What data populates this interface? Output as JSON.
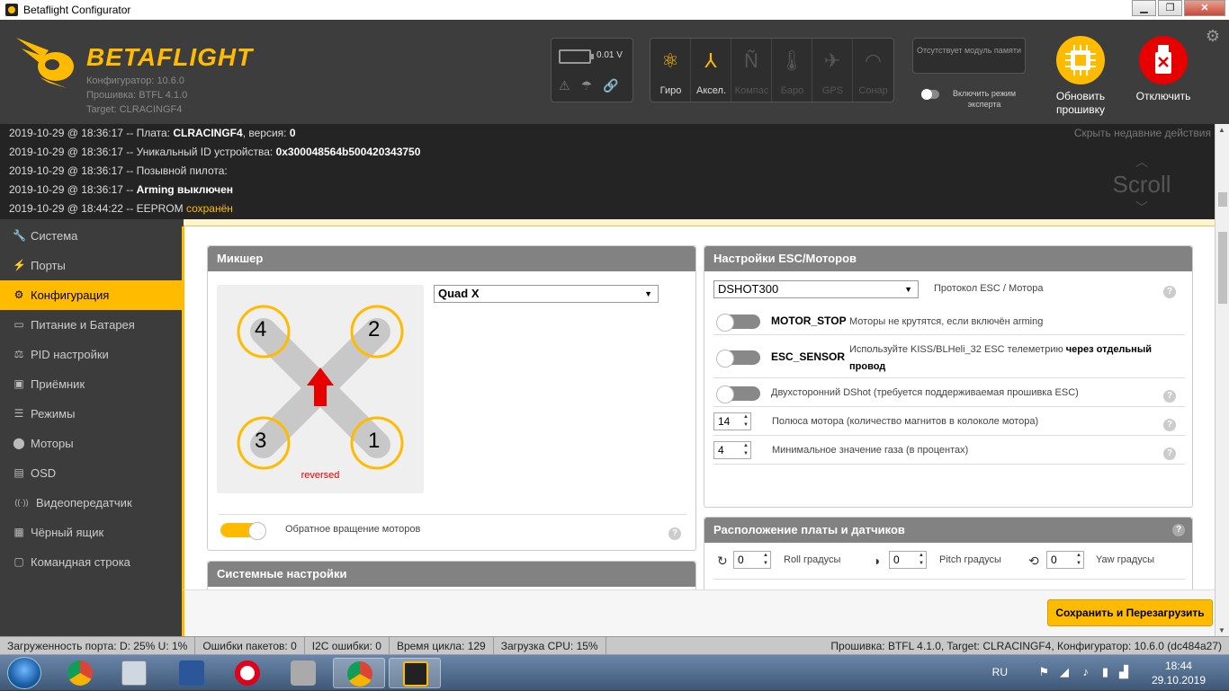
{
  "window": {
    "title": "Betaflight Configurator",
    "min": "▁",
    "max": "❐",
    "close": "✕"
  },
  "header": {
    "brand": "BETAFLIGHT",
    "configurator_version": "Конфигуратор: 10.6.0",
    "firmware_version": "Прошивка: BTFL 4.1.0",
    "target": "Target: CLRACINGF4",
    "battery_voltage": "0.01 V",
    "sensors": [
      {
        "label": "Гиро",
        "icon": "gyro-icon",
        "active": true
      },
      {
        "label": "Аксел.",
        "icon": "accel-icon",
        "active": true
      },
      {
        "label": "Компас",
        "icon": "compass-icon",
        "active": false
      },
      {
        "label": "Баро",
        "icon": "baro-icon",
        "active": false
      },
      {
        "label": "GPS",
        "icon": "gps-icon",
        "active": false
      },
      {
        "label": "Сонар",
        "icon": "sonar-icon",
        "active": false
      }
    ],
    "dataflash": "Отсутствует модуль памяти",
    "expert_mode": "Включить режим эксперта",
    "update_firmware": "Обновить прошивку",
    "disconnect": "Отключить"
  },
  "log": {
    "hide_label": "Скрыть недавние действия",
    "scroll_label": "Scroll",
    "lines": [
      {
        "prefix": "2019-10-29 @ 18:36:17 -- Плата: ",
        "bold": "CLRACINGF4",
        "suffix": ", версия: ",
        "bold2": "0",
        "hl": ""
      },
      {
        "prefix": "2019-10-29 @ 18:36:17 -- Уникальный ID устройства: ",
        "bold": "0x300048564b500420343750",
        "suffix": "",
        "bold2": "",
        "hl": ""
      },
      {
        "prefix": "2019-10-29 @ 18:36:17 -- Позывной пилота:",
        "bold": "",
        "suffix": "",
        "bold2": "",
        "hl": ""
      },
      {
        "prefix": "2019-10-29 @ 18:36:17 -- ",
        "bold": "Arming",
        "suffix": " ",
        "bold2": "выключен",
        "hl": ""
      },
      {
        "prefix": "2019-10-29 @ 18:44:22 -- EEPROM ",
        "bold": "",
        "suffix": "",
        "bold2": "",
        "hl": "сохранён"
      }
    ]
  },
  "sidebar": {
    "items": [
      {
        "label": "Система",
        "icon": "wrench-icon",
        "glyph": "🔧",
        "active": false
      },
      {
        "label": "Порты",
        "icon": "plug-icon",
        "glyph": "⚡",
        "active": false
      },
      {
        "label": "Конфигурация",
        "icon": "gear-icon",
        "glyph": "⚙",
        "active": true
      },
      {
        "label": "Питание и Батарея",
        "icon": "battery-icon",
        "glyph": "▭",
        "active": false
      },
      {
        "label": "PID настройки",
        "icon": "pid-icon",
        "glyph": "⚖",
        "active": false
      },
      {
        "label": "Приёмник",
        "icon": "receiver-icon",
        "glyph": "▣",
        "active": false
      },
      {
        "label": "Режимы",
        "icon": "modes-icon",
        "glyph": "☰",
        "active": false
      },
      {
        "label": "Моторы",
        "icon": "motor-icon",
        "glyph": "⬤",
        "active": false
      },
      {
        "label": "OSD",
        "icon": "osd-icon",
        "glyph": "▤",
        "active": false
      },
      {
        "label": "Видеопередатчик",
        "icon": "vtx-icon",
        "glyph": "((·))",
        "active": false
      },
      {
        "label": "Чёрный ящик",
        "icon": "blackbox-icon",
        "glyph": "▦",
        "active": false
      },
      {
        "label": "Командная строка",
        "icon": "cli-icon",
        "glyph": "▢",
        "active": false
      }
    ]
  },
  "mixer": {
    "title": "Микшер",
    "type": "Quad X",
    "motors": [
      "4",
      "2",
      "3",
      "1"
    ],
    "reversed": "reversed",
    "reverse_label": "Обратное вращение моторов",
    "reverse_on": true
  },
  "esc": {
    "title": "Настройки ESC/Моторов",
    "protocol": "DSHOT300",
    "protocol_label": "Протокол ESC / Мотора",
    "motor_stop_name": "MOTOR_STOP",
    "motor_stop_desc": "Моторы не крутятся, если включён arming",
    "esc_sensor_name": "ESC_SENSOR",
    "esc_sensor_desc": "Используйте KISS/BLHeli_32 ESC телеметрию ",
    "esc_sensor_bold": "через отдельный провод",
    "bidir_desc": "Двухсторонний DShot (требуется поддерживаемая прошивка ESC)",
    "poles_value": "14",
    "poles_desc": "Полюса мотора (количество магнитов в колоколе мотора)",
    "idle_value": "4",
    "idle_desc": "Минимальное значение газа (в процентах)"
  },
  "board": {
    "title": "Расположение платы и датчиков",
    "roll_value": "0",
    "roll_label": "Roll градусы",
    "pitch_value": "0",
    "pitch_label": "Pitch градусы",
    "yaw_value": "0",
    "yaw_label": "Yaw градусы"
  },
  "system": {
    "title": "Системные настройки"
  },
  "save_button": "Сохранить и Перезагрузить",
  "status": {
    "port_load": "Загруженность порта: D: 25% U: 1%",
    "packet_errors": "Ошибки пакетов: 0",
    "i2c_errors": "I2C ошибки: 0",
    "cycle_time": "Время цикла: 129",
    "cpu_load": "Загрузка CPU: 15%",
    "firmware_info": "Прошивка: BTFL 4.1.0, Target: CLRACINGF4, Конфигуратор: 10.6.0 (dc484a27)"
  },
  "taskbar": {
    "lang": "RU",
    "time": "18:44",
    "date": "29.10.2019"
  },
  "colors": {
    "accent": "#ffbb00",
    "danger": "#e60000",
    "panel_head": "#828282"
  }
}
